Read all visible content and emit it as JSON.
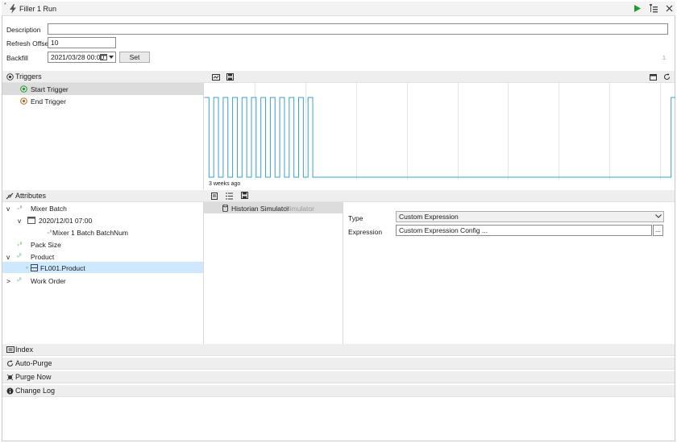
{
  "window": {
    "title": "Filler 1 Run",
    "corner_mark": "*",
    "page_indicator": "1"
  },
  "icons": {
    "title": "lightning-icon",
    "run": "play-icon",
    "tree": "tree-icon",
    "close": "close-icon"
  },
  "colors": {
    "accent_green": "#1f9d2f",
    "trend": "#3aa0c8",
    "selected_row": "#cde8ff",
    "selected_trigger": "#dcdcdc"
  },
  "form": {
    "description_label": "Description",
    "description_value": "",
    "refresh_offset_label": "Refresh Offset",
    "refresh_offset_value": "10",
    "backfill_label": "Backfill",
    "backfill_value": "2021/03/28 00:00",
    "set_label": "Set"
  },
  "triggers": {
    "header": "Triggers",
    "items": [
      {
        "label": "Start Trigger",
        "selected": true
      },
      {
        "label": "End Trigger",
        "selected": false
      }
    ]
  },
  "chart_data": {
    "type": "line",
    "xlabel": "3 weeks ago",
    "signal": [
      1,
      0,
      1,
      0,
      1,
      0,
      1,
      0,
      1,
      0,
      1,
      0,
      1,
      0,
      1,
      0,
      1,
      0,
      1,
      0,
      1,
      0,
      1,
      0,
      0,
      0,
      0,
      0,
      0,
      0,
      0,
      0,
      0,
      0,
      0,
      0,
      0,
      0,
      0,
      0,
      0,
      0,
      0,
      0,
      0,
      0,
      0,
      0,
      0,
      0,
      0,
      0,
      0,
      0,
      0,
      0,
      0,
      0,
      0,
      0,
      0,
      0,
      0,
      0,
      0,
      0,
      0,
      0,
      0,
      0,
      0,
      0,
      0,
      0,
      0,
      0,
      0,
      0,
      0,
      0,
      0,
      0,
      0,
      0,
      0,
      0,
      0,
      0,
      0,
      0,
      0,
      0,
      0,
      0,
      0,
      0,
      0,
      0,
      0,
      1
    ],
    "ylim": [
      0,
      1
    ],
    "grid": true
  },
  "attributes": {
    "header": "Attributes",
    "items": [
      {
        "label": "Mixer Batch",
        "indent": 0,
        "expander": "v"
      },
      {
        "label": "2020/12/01 07:00",
        "indent": 1,
        "expander": "v"
      },
      {
        "label": "Mixer 1 Batch BatchNum",
        "indent": 2,
        "expander": ""
      },
      {
        "label": "Pack Size",
        "indent": 0,
        "expander": ""
      },
      {
        "label": "Product",
        "indent": 0,
        "expander": "v"
      },
      {
        "label": "FL001.Product",
        "indent": 1,
        "expander": "",
        "selected": true
      },
      {
        "label": "Work Order",
        "indent": 0,
        "expander": ">"
      }
    ]
  },
  "source": {
    "name": "Historian Simulator",
    "type": "Simulator"
  },
  "details": {
    "type_label": "Type",
    "type_value": "Custom Expression",
    "expression_label": "Expression",
    "expression_value": "Custom Expression Config ...",
    "browse_label": "..."
  },
  "sections": [
    {
      "label": "Index",
      "icon": "index-icon"
    },
    {
      "label": "Auto-Purge",
      "icon": "refresh-icon"
    },
    {
      "label": "Purge Now",
      "icon": "purge-icon"
    },
    {
      "label": "Change Log",
      "icon": "info-icon"
    }
  ]
}
